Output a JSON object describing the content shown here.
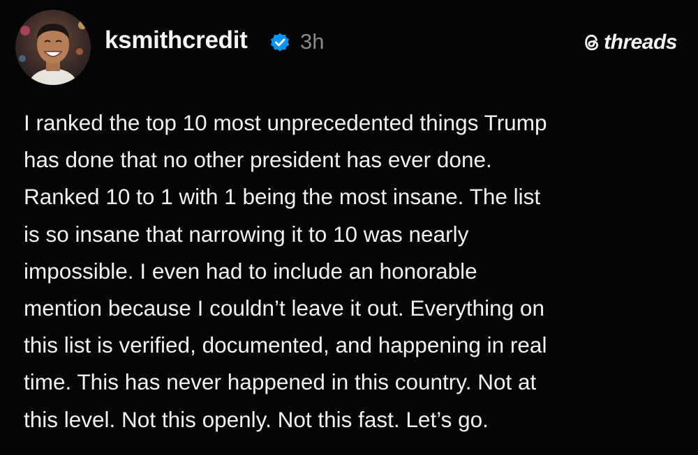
{
  "post": {
    "author": {
      "username": "ksmithcredit",
      "verified": true,
      "verified_icon": "verified-badge-icon",
      "avatar": "avatar-photo"
    },
    "timestamp": "3h",
    "brand": {
      "icon": "threads-logo-icon",
      "label": "threads"
    },
    "text": "I ranked the top 10 most unprecedented things Trump\nhas done that no other president has ever done.\nRanked 10 to 1 with 1 being the most insane. The list\nis so insane that narrowing it to 10 was nearly\nimpossible. I even had to include an honorable\nmention because I couldn’t leave it out. Everything on\nthis list is verified, documented, and happening in real\ntime. This has never happened in this country. Not at\nthis level. Not this openly. Not this fast. Let’s go."
  },
  "colors": {
    "background": "#050505",
    "text": "#f2f2f2",
    "muted": "#8a8a8a",
    "verified_blue": "#0095f6"
  }
}
